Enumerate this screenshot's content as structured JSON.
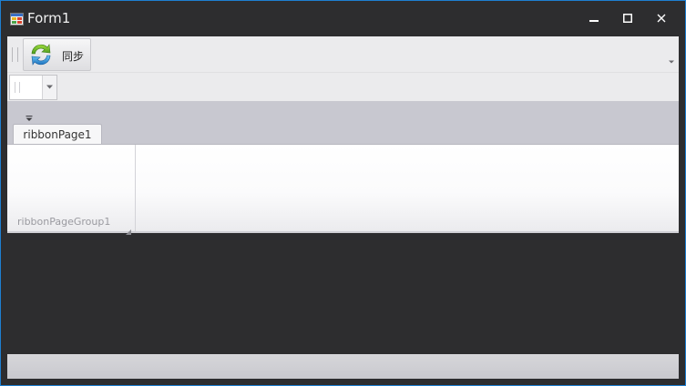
{
  "window": {
    "title": "Form1",
    "icon": "app-form-icon",
    "controls": [
      "minimize-icon",
      "maximize-icon",
      "close-icon"
    ]
  },
  "toolbar": {
    "sync_label": "同步",
    "sync_icon": "sync-icon"
  },
  "combo": {
    "value": ""
  },
  "ribbon": {
    "tabs": [
      {
        "label": "ribbonPage1"
      }
    ],
    "groups": [
      {
        "caption": "ribbonPageGroup1"
      }
    ]
  },
  "colors": {
    "window_border": "#1e7fd1",
    "title_background": "#2d2d2f",
    "ribbon_header": "#c8c8d0"
  }
}
